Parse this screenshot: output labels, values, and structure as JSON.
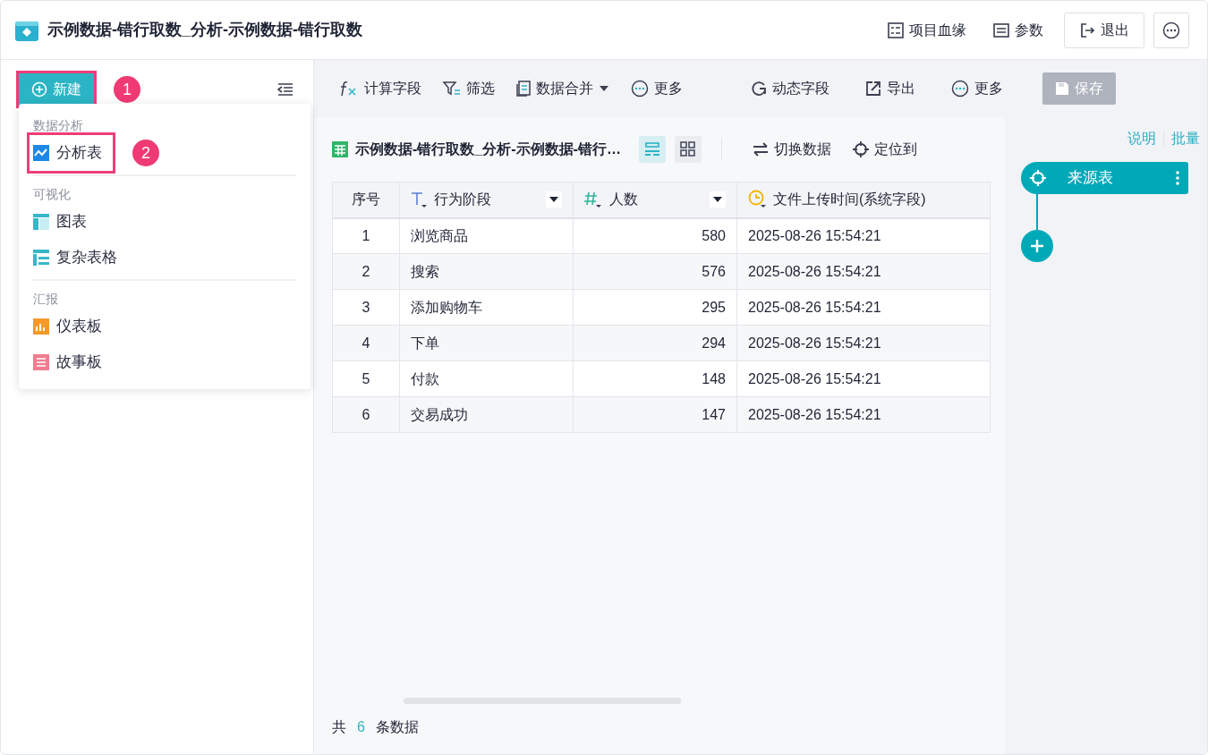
{
  "header": {
    "title": "示例数据-错行取数_分析-示例数据-错行取数",
    "actions": [
      {
        "label": "项目血缘",
        "kind": "text"
      },
      {
        "label": "参数",
        "kind": "text"
      },
      {
        "label": "退出",
        "kind": "outline"
      }
    ]
  },
  "sidebar": {
    "new_button": {
      "label": "新建",
      "highlighted": true,
      "step": "1"
    },
    "menu": [
      {
        "title": "数据分析",
        "items": [
          {
            "label": "分析表",
            "highlighted": true,
            "step": "2"
          }
        ]
      },
      {
        "title": "可视化",
        "items": [
          {
            "label": "图表",
            "highlighted": false
          },
          {
            "label": "复杂表格",
            "highlighted": false
          }
        ]
      },
      {
        "title": "汇报",
        "items": [
          {
            "label": "仪表板",
            "highlighted": false
          },
          {
            "label": "故事板",
            "highlighted": false
          }
        ]
      }
    ]
  },
  "toolbar": {
    "left": [
      {
        "label": "计算字段",
        "caret": false
      },
      {
        "label": "筛选",
        "caret": false
      },
      {
        "label": "数据合并",
        "caret": true
      },
      {
        "label": "更多",
        "caret": false
      }
    ],
    "right": [
      {
        "label": "动态字段"
      },
      {
        "label": "导出"
      },
      {
        "label": "更多"
      }
    ],
    "save": {
      "label": "保存",
      "disabled": true
    }
  },
  "dataset": {
    "title": "示例数据-错行取数_分析-示例数据-错行…",
    "views": [
      {
        "kind": "rows",
        "selected": true
      },
      {
        "kind": "grid",
        "selected": false
      }
    ],
    "actions": [
      {
        "label": "切换数据"
      },
      {
        "label": "定位到"
      }
    ]
  },
  "table": {
    "columns": [
      {
        "label": "序号",
        "kind": "index"
      },
      {
        "label": "行为阶段",
        "kind": "text"
      },
      {
        "label": "人数",
        "kind": "number"
      },
      {
        "label": "文件上传时间(系统字段)",
        "kind": "time"
      }
    ],
    "rows": [
      [
        "1",
        "浏览商品",
        "580",
        "2025-08-26 15:54:21"
      ],
      [
        "2",
        "搜索",
        "576",
        "2025-08-26 15:54:21"
      ],
      [
        "3",
        "添加购物车",
        "295",
        "2025-08-26 15:54:21"
      ],
      [
        "4",
        "下单",
        "294",
        "2025-08-26 15:54:21"
      ],
      [
        "5",
        "付款",
        "148",
        "2025-08-26 15:54:21"
      ],
      [
        "6",
        "交易成功",
        "147",
        "2025-08-26 15:54:21"
      ]
    ]
  },
  "footer": {
    "prefix": "共",
    "count": "6",
    "suffix": "条数据"
  },
  "flow": {
    "links": [
      "说明",
      "批量"
    ],
    "node": "来源表"
  }
}
